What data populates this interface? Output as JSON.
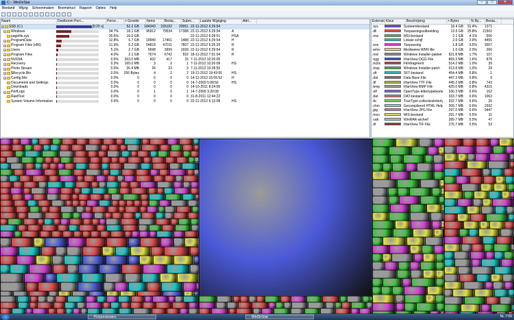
{
  "window": {
    "title": "C: - WinDirStat"
  },
  "window_buttons": {
    "minimize": "–",
    "maximize": "□",
    "close": "✕"
  },
  "menu": [
    "Bestand",
    "Wijzig",
    "Schoonmaken",
    "Boomstruct",
    "Rapport",
    "Opties",
    "Help"
  ],
  "toolbar_icons": [
    "open-folder-icon",
    "refresh-icon",
    "copy-icon",
    "explorer-icon",
    "cmd-icon",
    "refresh-all-icon",
    "delete-icon",
    "delete-permanent-icon",
    "properties-icon",
    "zoom-in-icon",
    "zoom-out-icon",
    "select-parent-icon",
    "help-icon"
  ],
  "dir_tree": {
    "columns": [
      "Naam",
      "Deelboom Perc...",
      "Perce...",
      "> Grootte",
      "Items",
      "Besta...",
      "Subm...",
      "Laatste Wijziging",
      "Attri..."
    ],
    "rows": [
      {
        "name": "SSD (C:)",
        "bar": "[9:29 s]",
        "pct": "",
        "size": "52.2 GB",
        "items": "184343",
        "files": "155192",
        "subdirs": "29051",
        "modified": "22-11-2012 6:29:54",
        "attr": "",
        "fill": 1.0,
        "exp": "−"
      },
      {
        "name": "Windows",
        "bar": "",
        "pct": "34.7%",
        "size": "18.1 GB",
        "items": "96912",
        "files": "79534",
        "subdirs": "17388",
        "modified": "22-11-2012 6:29:54",
        "attr": "A",
        "fill": 0.347,
        "exp": "+"
      },
      {
        "name": "pagefile.sys",
        "bar": "",
        "pct": "30.6%",
        "size": "16.0 GB",
        "items": "",
        "files": "",
        "subdirs": "",
        "modified": "22-11-2012 6:28:51",
        "attr": "HSA",
        "fill": 0.306,
        "exp": ""
      },
      {
        "name": "ProgramData",
        "bar": "",
        "pct": "12.8%",
        "size": "6.7 GB",
        "items": "18949",
        "files": "17461",
        "subdirs": "1488",
        "modified": "22-11-2012 6:29:54",
        "attr": "H",
        "fill": 0.128,
        "exp": "+"
      },
      {
        "name": "Program Files (x86)",
        "bar": "",
        "pct": "11.9%",
        "size": "6.2 GB",
        "items": "54818",
        "files": "47011",
        "subdirs": "7807",
        "modified": "22-11-2012 6:25:20",
        "attr": "R",
        "fill": 0.119,
        "exp": "+"
      },
      {
        "name": "Users",
        "bar": "",
        "pct": "5.1%",
        "size": "2.7 GB",
        "items": "5698",
        "files": "3999",
        "subdirs": "1699",
        "modified": "22-11-2012 6:29:54",
        "attr": "R",
        "fill": 0.051,
        "exp": "+"
      },
      {
        "name": "Program Files",
        "bar": "",
        "pct": "4.0%",
        "size": "2.1 GB",
        "items": "7674",
        "files": "6742",
        "subdirs": "932",
        "modified": "18-11-2012 7:01:04",
        "attr": "R",
        "fill": 0.04,
        "exp": "+"
      },
      {
        "name": "NVIDIA",
        "bar": "",
        "pct": "0.5%",
        "size": "263.0 MB",
        "items": "432",
        "files": "417",
        "subdirs": "15",
        "modified": "7-11-2012 10:20:05",
        "attr": "",
        "fill": 0.005,
        "exp": "+"
      },
      {
        "name": "Recovery",
        "bar": "",
        "pct": "0.3%",
        "size": "165.0 MB",
        "items": "3",
        "files": "2",
        "subdirs": "1",
        "modified": "7-11-2012 10:26:09",
        "attr": "HS",
        "fill": 0.003,
        "exp": "+"
      },
      {
        "name": "Photo Stream",
        "bar": "",
        "pct": "0.0%",
        "size": "26.4 MB",
        "items": "26",
        "files": "23",
        "subdirs": "3",
        "modified": "7-11-2012 10:28:55",
        "attr": "",
        "fill": 0.0,
        "exp": "+"
      },
      {
        "name": "$Recycle.Bin",
        "bar": "",
        "pct": "0.0%",
        "size": "256 Bytes",
        "items": "4",
        "files": "2",
        "subdirs": "2",
        "modified": "19-11-2012 19:43:05",
        "attr": "HS",
        "fill": 0.0,
        "exp": "+"
      },
      {
        "name": "Config.Msi",
        "bar": "",
        "pct": "0.0%",
        "size": "0",
        "items": "0",
        "files": "0",
        "subdirs": "0",
        "modified": "14-11-2012 15:06:52",
        "attr": "H",
        "fill": 0.0,
        "exp": "+"
      },
      {
        "name": "Documents and Settings",
        "bar": "",
        "pct": "0.0%",
        "size": "0",
        "items": "0",
        "files": "0",
        "subdirs": "0",
        "modified": "14-7-2009 5:08:56",
        "attr": "HS",
        "fill": 0.0,
        "exp": ""
      },
      {
        "name": "Downloads",
        "bar": "",
        "pct": "0.0%",
        "size": "0",
        "items": "0",
        "files": "0",
        "subdirs": "0",
        "modified": "14-10-2011 8:24:06",
        "attr": "",
        "fill": 0.0,
        "exp": ""
      },
      {
        "name": "PerfLogs",
        "bar": "",
        "pct": "0.0%",
        "size": "0",
        "items": "1",
        "files": "0",
        "subdirs": "1",
        "modified": "14-7-2009 3:20:08",
        "attr": "",
        "fill": 0.0,
        "exp": "+"
      },
      {
        "name": "RaidTool",
        "bar": "",
        "pct": "0.0%",
        "size": "0",
        "items": "0",
        "files": "0",
        "subdirs": "0",
        "modified": "31-8-2011 12:44:22",
        "attr": "",
        "fill": 0.0,
        "exp": ""
      },
      {
        "name": "System Volume Information",
        "bar": "",
        "pct": "0.0%",
        "size": "0",
        "items": "0",
        "files": "0",
        "subdirs": "0",
        "modified": "22-11-2012 6:13:08",
        "attr": "HS",
        "fill": 0.0,
        "exp": ""
      }
    ]
  },
  "ext_list": {
    "columns": [
      "Extensie",
      "Kleur",
      "Beschrijving",
      "> Bytes",
      "% By...",
      "Besta..."
    ],
    "rows": [
      {
        "ext": ".sys",
        "color": "#4b5ad8",
        "desc": "Systeembestand",
        "bytes": "16.4 GB",
        "pct": "31.4%",
        "files": "1371"
      },
      {
        "ext": ".dll",
        "color": "#e04a4a",
        "desc": "Toepassingsuitbreiding",
        "bytes": "13.5 GB",
        "pct": "25.8%",
        "files": "21502"
      },
      {
        "ext": ".msi",
        "color": "#3fc63f",
        "desc": "MSI-bestand",
        "bytes": "2.1 GB",
        "pct": "4.1%",
        "files": "556"
      },
      {
        "ext": ".",
        "color": "#16c7c7",
        "desc": "Lokale schijf",
        "bytes": "2.0 GB",
        "pct": "3.9%",
        "files": "4455"
      },
      {
        "ext": ".exe",
        "color": "#d63fd6",
        "desc": "Toepassing",
        "bytes": "1.8 GB",
        "pct": "3.5%",
        "files": "3007"
      },
      {
        "ext": ".wmv",
        "color": "#e0e040",
        "desc": "Mediaview WMV-file",
        "bytes": "1.0 GB",
        "pct": "2.0%",
        "files": "266"
      },
      {
        "ext": ".msi",
        "color": "#8a8a8a",
        "desc": "Windows Installer-pakket",
        "bytes": "921.8 MB",
        "pct": "1.7%",
        "files": "107"
      },
      {
        "ext": ".ogg",
        "color": "#4a4ab0",
        "desc": "IrfanView OGG File",
        "bytes": "869.3 MB",
        "pct": "1.6%",
        "files": "878"
      },
      {
        "ext": ".m2ts",
        "color": "#b04a4a",
        "desc": "Filmfragment",
        "bytes": "514.2 MB",
        "pct": "1.0%",
        "files": "39"
      },
      {
        "ext": ".msp",
        "color": "#4ab04a",
        "desc": "Windows Installer-patch",
        "bytes": "513.8 MB",
        "pct": "1.0%",
        "files": "24"
      },
      {
        "ext": ".sft",
        "color": "#4ab0b0",
        "desc": "SFT-bestand",
        "bytes": "454.4 MB",
        "pct": "0.8%",
        "files": "1"
      },
      {
        "ext": ".dat",
        "color": "#b04ab0",
        "desc": "Data Base File",
        "bytes": "447.3 MB",
        "pct": "0.8%",
        "files": "9"
      },
      {
        "ext": ".ttf",
        "color": "#b0b04a",
        "desc": "IrfanView TTF File",
        "bytes": "445.2 MB",
        "pct": "0.8%",
        "files": "743"
      },
      {
        "ext": ".bmp",
        "color": "#9a9a9a",
        "desc": "IrfanView BMP File",
        "bytes": "425.0 MB",
        "pct": "0.8%",
        "files": "4316"
      },
      {
        "ext": ".otf",
        "color": "#6c6cd8",
        "desc": "OpenType-lettertypebestand",
        "bytes": "336.3 MB",
        "pct": "0.6%",
        "files": "162"
      },
      {
        "ext": ".dat",
        "color": "#d86c6c",
        "desc": "DAT-bestand",
        "bytes": "333.7 MB",
        "pct": "0.6%",
        "files": "1063"
      },
      {
        "ext": ".ttc",
        "color": "#6cd86c",
        "desc": "TrueType-collectieslettertype...",
        "bytes": "332.7 MB",
        "pct": "0.6%",
        "files": "26"
      },
      {
        "ext": ".chm",
        "color": "#6cd8d8",
        "desc": "Gecompileerd HTML Help-...",
        "bytes": "309.7 MB",
        "pct": "0.6%",
        "files": "1592"
      },
      {
        "ext": ".jpg",
        "color": "#d86cd8",
        "desc": "IrfanView JPG File",
        "bytes": "297.0 MB",
        "pct": "0.6%",
        "files": "3447"
      },
      {
        "ext": ".msu",
        "color": "#d8d86c",
        "desc": "MIS-bestand",
        "bytes": "291.7 MB",
        "pct": "0.5%",
        "files": "11"
      },
      {
        "ext": ".cab",
        "color": "#b8b8b8",
        "desc": "WinRAR-archief",
        "bytes": "289.7 MB",
        "pct": "0.5%",
        "files": "47"
      },
      {
        "ext": ".tif",
        "color": "#8a3a3a",
        "desc": "IrfanView TIF File",
        "bytes": "276.7 MB",
        "pct": "0.5%",
        "files": "53"
      }
    ]
  },
  "taskbar": {
    "task1": "Pictureviewers",
    "task2": "WinDirStat",
    "tray": "NL",
    "clock": "7:06"
  }
}
